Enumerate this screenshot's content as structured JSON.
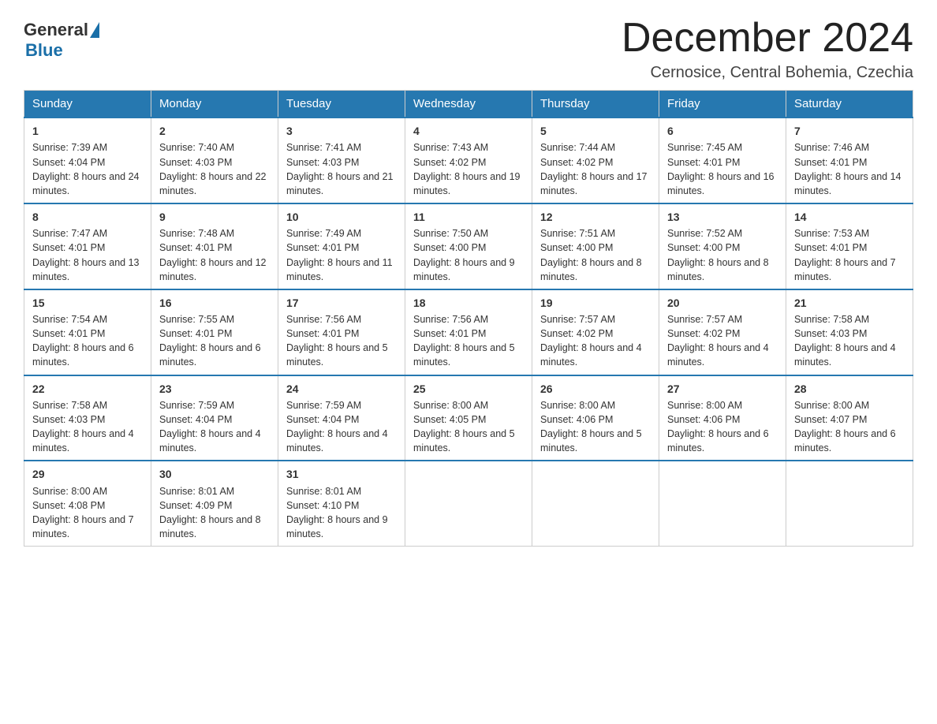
{
  "header": {
    "logo_general": "General",
    "logo_blue": "Blue",
    "month_title": "December 2024",
    "location": "Cernosice, Central Bohemia, Czechia"
  },
  "days_of_week": [
    "Sunday",
    "Monday",
    "Tuesday",
    "Wednesday",
    "Thursday",
    "Friday",
    "Saturday"
  ],
  "weeks": [
    [
      {
        "day": "1",
        "sunrise": "Sunrise: 7:39 AM",
        "sunset": "Sunset: 4:04 PM",
        "daylight": "Daylight: 8 hours and 24 minutes."
      },
      {
        "day": "2",
        "sunrise": "Sunrise: 7:40 AM",
        "sunset": "Sunset: 4:03 PM",
        "daylight": "Daylight: 8 hours and 22 minutes."
      },
      {
        "day": "3",
        "sunrise": "Sunrise: 7:41 AM",
        "sunset": "Sunset: 4:03 PM",
        "daylight": "Daylight: 8 hours and 21 minutes."
      },
      {
        "day": "4",
        "sunrise": "Sunrise: 7:43 AM",
        "sunset": "Sunset: 4:02 PM",
        "daylight": "Daylight: 8 hours and 19 minutes."
      },
      {
        "day": "5",
        "sunrise": "Sunrise: 7:44 AM",
        "sunset": "Sunset: 4:02 PM",
        "daylight": "Daylight: 8 hours and 17 minutes."
      },
      {
        "day": "6",
        "sunrise": "Sunrise: 7:45 AM",
        "sunset": "Sunset: 4:01 PM",
        "daylight": "Daylight: 8 hours and 16 minutes."
      },
      {
        "day": "7",
        "sunrise": "Sunrise: 7:46 AM",
        "sunset": "Sunset: 4:01 PM",
        "daylight": "Daylight: 8 hours and 14 minutes."
      }
    ],
    [
      {
        "day": "8",
        "sunrise": "Sunrise: 7:47 AM",
        "sunset": "Sunset: 4:01 PM",
        "daylight": "Daylight: 8 hours and 13 minutes."
      },
      {
        "day": "9",
        "sunrise": "Sunrise: 7:48 AM",
        "sunset": "Sunset: 4:01 PM",
        "daylight": "Daylight: 8 hours and 12 minutes."
      },
      {
        "day": "10",
        "sunrise": "Sunrise: 7:49 AM",
        "sunset": "Sunset: 4:01 PM",
        "daylight": "Daylight: 8 hours and 11 minutes."
      },
      {
        "day": "11",
        "sunrise": "Sunrise: 7:50 AM",
        "sunset": "Sunset: 4:00 PM",
        "daylight": "Daylight: 8 hours and 9 minutes."
      },
      {
        "day": "12",
        "sunrise": "Sunrise: 7:51 AM",
        "sunset": "Sunset: 4:00 PM",
        "daylight": "Daylight: 8 hours and 8 minutes."
      },
      {
        "day": "13",
        "sunrise": "Sunrise: 7:52 AM",
        "sunset": "Sunset: 4:00 PM",
        "daylight": "Daylight: 8 hours and 8 minutes."
      },
      {
        "day": "14",
        "sunrise": "Sunrise: 7:53 AM",
        "sunset": "Sunset: 4:01 PM",
        "daylight": "Daylight: 8 hours and 7 minutes."
      }
    ],
    [
      {
        "day": "15",
        "sunrise": "Sunrise: 7:54 AM",
        "sunset": "Sunset: 4:01 PM",
        "daylight": "Daylight: 8 hours and 6 minutes."
      },
      {
        "day": "16",
        "sunrise": "Sunrise: 7:55 AM",
        "sunset": "Sunset: 4:01 PM",
        "daylight": "Daylight: 8 hours and 6 minutes."
      },
      {
        "day": "17",
        "sunrise": "Sunrise: 7:56 AM",
        "sunset": "Sunset: 4:01 PM",
        "daylight": "Daylight: 8 hours and 5 minutes."
      },
      {
        "day": "18",
        "sunrise": "Sunrise: 7:56 AM",
        "sunset": "Sunset: 4:01 PM",
        "daylight": "Daylight: 8 hours and 5 minutes."
      },
      {
        "day": "19",
        "sunrise": "Sunrise: 7:57 AM",
        "sunset": "Sunset: 4:02 PM",
        "daylight": "Daylight: 8 hours and 4 minutes."
      },
      {
        "day": "20",
        "sunrise": "Sunrise: 7:57 AM",
        "sunset": "Sunset: 4:02 PM",
        "daylight": "Daylight: 8 hours and 4 minutes."
      },
      {
        "day": "21",
        "sunrise": "Sunrise: 7:58 AM",
        "sunset": "Sunset: 4:03 PM",
        "daylight": "Daylight: 8 hours and 4 minutes."
      }
    ],
    [
      {
        "day": "22",
        "sunrise": "Sunrise: 7:58 AM",
        "sunset": "Sunset: 4:03 PM",
        "daylight": "Daylight: 8 hours and 4 minutes."
      },
      {
        "day": "23",
        "sunrise": "Sunrise: 7:59 AM",
        "sunset": "Sunset: 4:04 PM",
        "daylight": "Daylight: 8 hours and 4 minutes."
      },
      {
        "day": "24",
        "sunrise": "Sunrise: 7:59 AM",
        "sunset": "Sunset: 4:04 PM",
        "daylight": "Daylight: 8 hours and 4 minutes."
      },
      {
        "day": "25",
        "sunrise": "Sunrise: 8:00 AM",
        "sunset": "Sunset: 4:05 PM",
        "daylight": "Daylight: 8 hours and 5 minutes."
      },
      {
        "day": "26",
        "sunrise": "Sunrise: 8:00 AM",
        "sunset": "Sunset: 4:06 PM",
        "daylight": "Daylight: 8 hours and 5 minutes."
      },
      {
        "day": "27",
        "sunrise": "Sunrise: 8:00 AM",
        "sunset": "Sunset: 4:06 PM",
        "daylight": "Daylight: 8 hours and 6 minutes."
      },
      {
        "day": "28",
        "sunrise": "Sunrise: 8:00 AM",
        "sunset": "Sunset: 4:07 PM",
        "daylight": "Daylight: 8 hours and 6 minutes."
      }
    ],
    [
      {
        "day": "29",
        "sunrise": "Sunrise: 8:00 AM",
        "sunset": "Sunset: 4:08 PM",
        "daylight": "Daylight: 8 hours and 7 minutes."
      },
      {
        "day": "30",
        "sunrise": "Sunrise: 8:01 AM",
        "sunset": "Sunset: 4:09 PM",
        "daylight": "Daylight: 8 hours and 8 minutes."
      },
      {
        "day": "31",
        "sunrise": "Sunrise: 8:01 AM",
        "sunset": "Sunset: 4:10 PM",
        "daylight": "Daylight: 8 hours and 9 minutes."
      },
      null,
      null,
      null,
      null
    ]
  ]
}
